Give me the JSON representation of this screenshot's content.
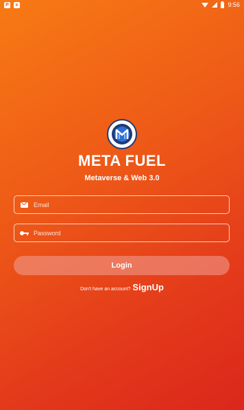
{
  "status_bar": {
    "time": "9:56",
    "left_icons": [
      "notification-icon",
      "alert-icon"
    ],
    "right_icons": [
      "wifi-icon",
      "signal-icon",
      "battery-icon"
    ]
  },
  "app": {
    "logo_icon": "meta-fuel-logo",
    "title": "META FUEL",
    "subtitle": "Metaverse & Web 3.0"
  },
  "form": {
    "email": {
      "placeholder": "Email",
      "value": "",
      "icon": "mail-icon"
    },
    "password": {
      "placeholder": "Password",
      "value": "",
      "icon": "key-icon"
    },
    "login_label": "Login"
  },
  "signup": {
    "prompt": "Don't have an account?",
    "link_label": "SignUp"
  },
  "colors": {
    "background_top": "#f77a14",
    "background_bottom": "#db271b",
    "logo_ring": "#1f3b77",
    "button_fill": "#f0a096"
  }
}
